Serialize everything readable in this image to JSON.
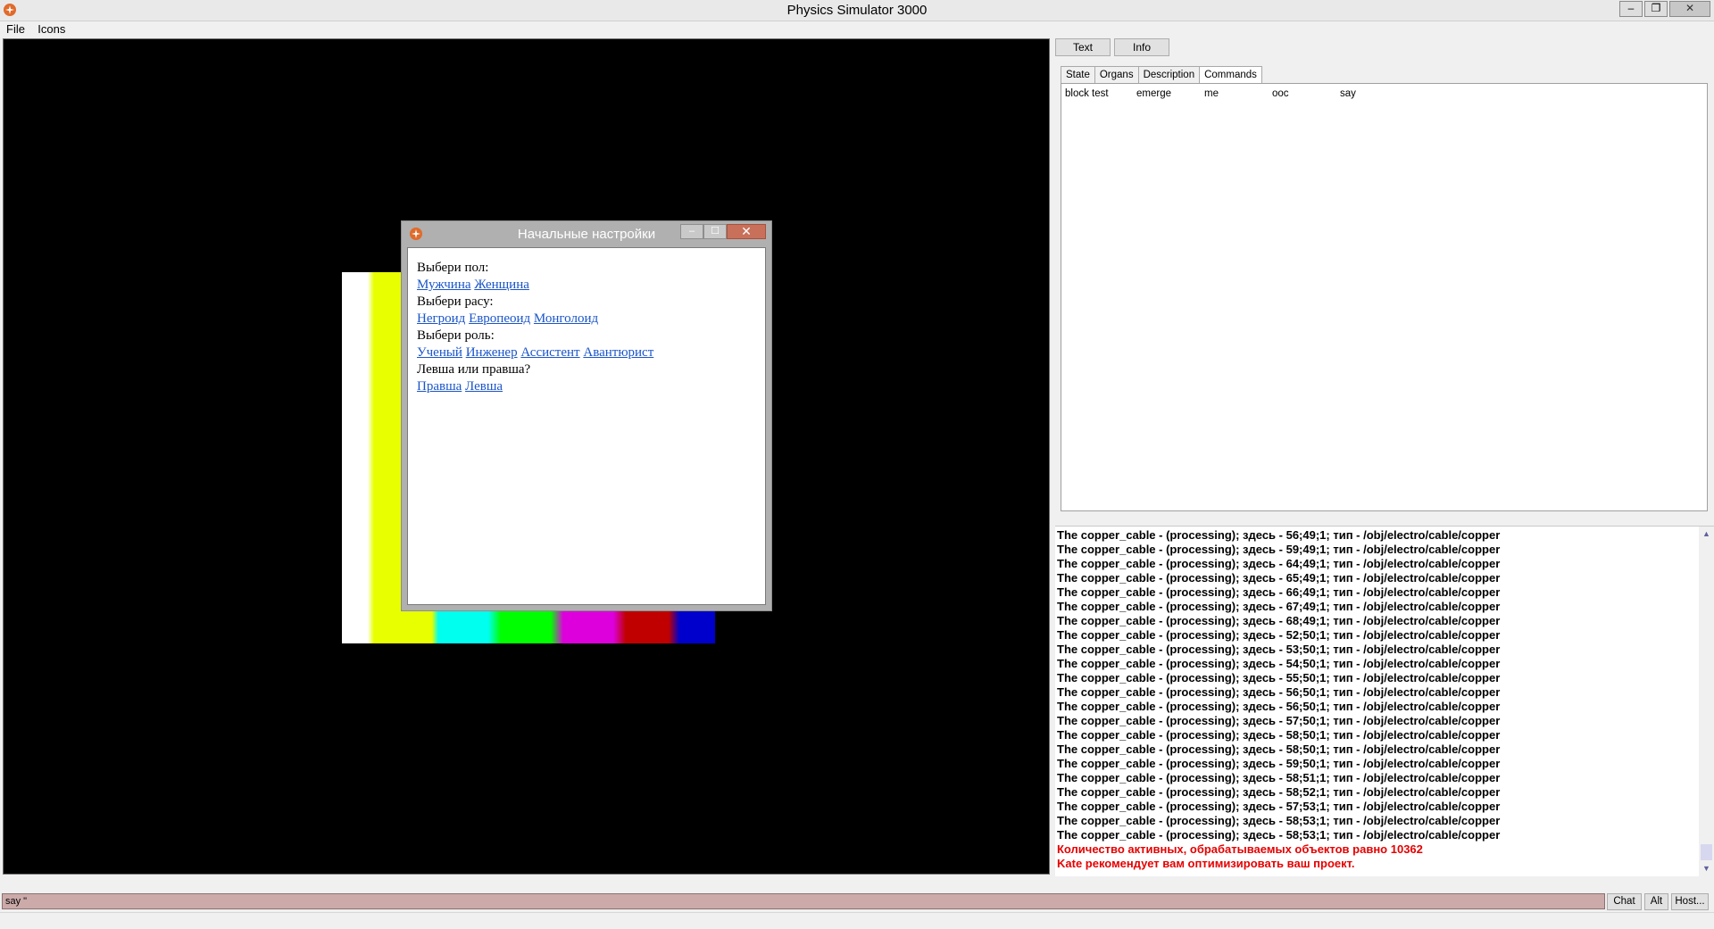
{
  "window": {
    "title": "Physics Simulator 3000",
    "minimize": "–",
    "restore": "❐",
    "close": "✕"
  },
  "menu": {
    "items": [
      "File",
      "Icons"
    ]
  },
  "viewport": {
    "bar_colors": [
      "#ffffff",
      "#e8ff00",
      "#e8ff00",
      "#00ffee",
      "#00ff00",
      "#dd00dd",
      "#c00000",
      "#0000cc"
    ]
  },
  "dialog": {
    "title": "Начальные настройки",
    "minimize": "–",
    "maximize": "☐",
    "close": "✕",
    "gender_prompt": "Выбери пол:",
    "gender_options": [
      "Мужчина",
      "Женщина"
    ],
    "race_prompt": "Выбери расу:",
    "race_options": [
      "Негроид",
      "Европеоид",
      "Монголоид"
    ],
    "role_prompt": "Выбери роль:",
    "role_options": [
      "Ученый",
      "Инженер",
      "Ассистент",
      "Авантюрист"
    ],
    "hand_prompt": "Левша или правша?",
    "hand_options": [
      "Правша",
      "Левша"
    ]
  },
  "right_panel": {
    "buttons": {
      "text": "Text",
      "info": "Info"
    },
    "tabs": [
      "State",
      "Organs",
      "Description",
      "Commands"
    ],
    "active_tab": "Commands",
    "commands": [
      "block test",
      "emerge",
      "me",
      "ooc",
      "say"
    ]
  },
  "log": {
    "lines": [
      "The copper_cable - (processing); здесь - 56;49;1; тип - /obj/electro/cable/copper",
      "The copper_cable - (processing); здесь - 59;49;1; тип - /obj/electro/cable/copper",
      "The copper_cable - (processing); здесь - 64;49;1; тип - /obj/electro/cable/copper",
      "The copper_cable - (processing); здесь - 65;49;1; тип - /obj/electro/cable/copper",
      "The copper_cable - (processing); здесь - 66;49;1; тип - /obj/electro/cable/copper",
      "The copper_cable - (processing); здесь - 67;49;1; тип - /obj/electro/cable/copper",
      "The copper_cable - (processing); здесь - 68;49;1; тип - /obj/electro/cable/copper",
      "The copper_cable - (processing); здесь - 52;50;1; тип - /obj/electro/cable/copper",
      "The copper_cable - (processing); здесь - 53;50;1; тип - /obj/electro/cable/copper",
      "The copper_cable - (processing); здесь - 54;50;1; тип - /obj/electro/cable/copper",
      "The copper_cable - (processing); здесь - 55;50;1; тип - /obj/electro/cable/copper",
      "The copper_cable - (processing); здесь - 56;50;1; тип - /obj/electro/cable/copper",
      "The copper_cable - (processing); здесь - 56;50;1; тип - /obj/electro/cable/copper",
      "The copper_cable - (processing); здесь - 57;50;1; тип - /obj/electro/cable/copper",
      "The copper_cable - (processing); здесь - 58;50;1; тип - /obj/electro/cable/copper",
      "The copper_cable - (processing); здесь - 58;50;1; тип - /obj/electro/cable/copper",
      "The copper_cable - (processing); здесь - 59;50;1; тип - /obj/electro/cable/copper",
      "The copper_cable - (processing); здесь - 58;51;1; тип - /obj/electro/cable/copper",
      "The copper_cable - (processing); здесь - 58;52;1; тип - /obj/electro/cable/copper",
      "The copper_cable - (processing); здесь - 57;53;1; тип - /obj/electro/cable/copper",
      "The copper_cable - (processing); здесь - 58;53;1; тип - /obj/electro/cable/copper",
      "The copper_cable - (processing); здесь - 58;53;1; тип - /obj/electro/cable/copper"
    ],
    "warnings": [
      "Количество активных, обрабатываемых объектов равно 10362",
      "Kate рекомендует вам оптимизировать ваш проект."
    ]
  },
  "input": {
    "value": "say \""
  },
  "bottom_buttons": {
    "chat": "Chat",
    "alt": "Alt",
    "host": "Host..."
  }
}
